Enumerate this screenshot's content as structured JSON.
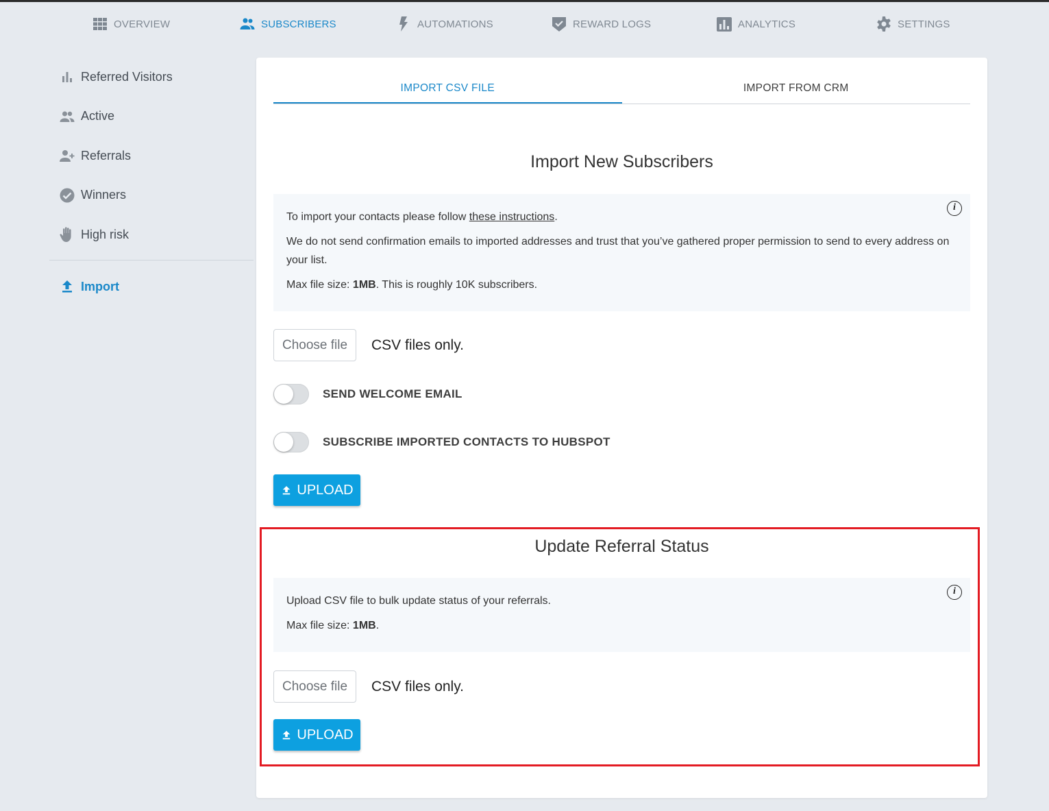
{
  "topnav": {
    "items": [
      {
        "label": "OVERVIEW",
        "icon": "grid-icon"
      },
      {
        "label": "SUBSCRIBERS",
        "icon": "people-icon",
        "active": true
      },
      {
        "label": "AUTOMATIONS",
        "icon": "bolt-icon"
      },
      {
        "label": "REWARD LOGS",
        "icon": "shield-check-icon"
      },
      {
        "label": "ANALYTICS",
        "icon": "bar-chart-icon"
      },
      {
        "label": "SETTINGS",
        "icon": "gear-icon"
      }
    ]
  },
  "sidebar": {
    "items": [
      {
        "label": "Referred Visitors",
        "icon": "bar-chart-icon"
      },
      {
        "label": "Active",
        "icon": "people-icon"
      },
      {
        "label": "Referrals",
        "icon": "person-add-icon"
      },
      {
        "label": "Winners",
        "icon": "check-circle-icon"
      },
      {
        "label": "High risk",
        "icon": "hand-icon"
      }
    ],
    "import": {
      "label": "Import",
      "icon": "upload-icon",
      "active": true
    }
  },
  "tabs": [
    {
      "label": "IMPORT CSV FILE",
      "active": true
    },
    {
      "label": "IMPORT FROM CRM",
      "active": false
    }
  ],
  "import_section": {
    "title": "Import New Subscribers",
    "info": {
      "line1_prefix": "To import your contacts please follow ",
      "line1_link": "these instructions",
      "line1_suffix": ".",
      "line2": "We do not send confirmation emails to imported addresses and trust that you’ve gathered proper permission to send to every address on your list.",
      "line3_prefix": "Max file size: ",
      "line3_bold": "1MB",
      "line3_suffix": ". This is roughly 10K subscribers."
    },
    "choose_file": "Choose file",
    "file_hint": "CSV files only.",
    "toggles": [
      {
        "label": "SEND WELCOME EMAIL",
        "on": false
      },
      {
        "label": "SUBSCRIBE IMPORTED CONTACTS TO HUBSPOT",
        "on": false
      }
    ],
    "upload_label": "UPLOAD"
  },
  "update_section": {
    "title": "Update Referral Status",
    "info": {
      "line1": "Upload CSV file to bulk update status of your referrals.",
      "line2_prefix": "Max file size: ",
      "line2_bold": "1MB",
      "line2_suffix": "."
    },
    "choose_file": "Choose file",
    "file_hint": "CSV files only.",
    "upload_label": "UPLOAD"
  },
  "colors": {
    "accent": "#1a88c9",
    "upload_button": "#0da0e0",
    "highlight": "#e31b23",
    "background": "#e6eaef",
    "info_box": "#f5f8fb"
  }
}
